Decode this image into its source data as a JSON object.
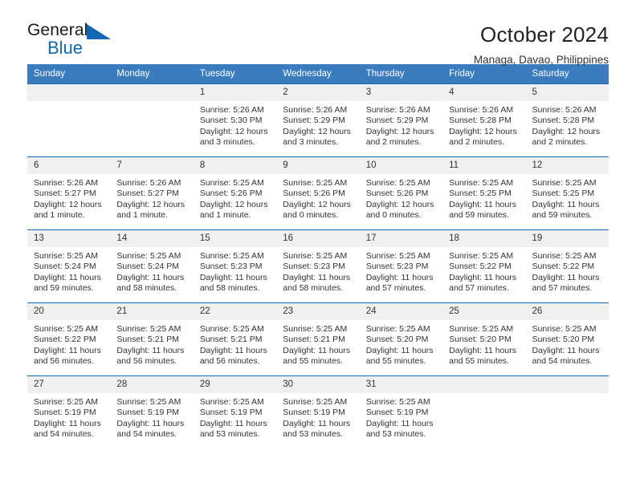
{
  "logo": {
    "word_top": "General",
    "word_bottom": "Blue",
    "accent_color": "#1268b3"
  },
  "header": {
    "title": "October 2024",
    "subtitle": "Managa, Davao, Philippines"
  },
  "calendar": {
    "header_bg": "#3a7cbe",
    "weekday_headers": [
      "Sunday",
      "Monday",
      "Tuesday",
      "Wednesday",
      "Thursday",
      "Friday",
      "Saturday"
    ],
    "weeks": [
      [
        {
          "day": "",
          "lines": []
        },
        {
          "day": "",
          "lines": []
        },
        {
          "day": "1",
          "lines": [
            "Sunrise: 5:26 AM",
            "Sunset: 5:30 PM",
            "Daylight: 12 hours",
            "and 3 minutes."
          ]
        },
        {
          "day": "2",
          "lines": [
            "Sunrise: 5:26 AM",
            "Sunset: 5:29 PM",
            "Daylight: 12 hours",
            "and 3 minutes."
          ]
        },
        {
          "day": "3",
          "lines": [
            "Sunrise: 5:26 AM",
            "Sunset: 5:29 PM",
            "Daylight: 12 hours",
            "and 2 minutes."
          ]
        },
        {
          "day": "4",
          "lines": [
            "Sunrise: 5:26 AM",
            "Sunset: 5:28 PM",
            "Daylight: 12 hours",
            "and 2 minutes."
          ]
        },
        {
          "day": "5",
          "lines": [
            "Sunrise: 5:26 AM",
            "Sunset: 5:28 PM",
            "Daylight: 12 hours",
            "and 2 minutes."
          ]
        }
      ],
      [
        {
          "day": "6",
          "lines": [
            "Sunrise: 5:26 AM",
            "Sunset: 5:27 PM",
            "Daylight: 12 hours",
            "and 1 minute."
          ]
        },
        {
          "day": "7",
          "lines": [
            "Sunrise: 5:26 AM",
            "Sunset: 5:27 PM",
            "Daylight: 12 hours",
            "and 1 minute."
          ]
        },
        {
          "day": "8",
          "lines": [
            "Sunrise: 5:25 AM",
            "Sunset: 5:26 PM",
            "Daylight: 12 hours",
            "and 1 minute."
          ]
        },
        {
          "day": "9",
          "lines": [
            "Sunrise: 5:25 AM",
            "Sunset: 5:26 PM",
            "Daylight: 12 hours",
            "and 0 minutes."
          ]
        },
        {
          "day": "10",
          "lines": [
            "Sunrise: 5:25 AM",
            "Sunset: 5:26 PM",
            "Daylight: 12 hours",
            "and 0 minutes."
          ]
        },
        {
          "day": "11",
          "lines": [
            "Sunrise: 5:25 AM",
            "Sunset: 5:25 PM",
            "Daylight: 11 hours",
            "and 59 minutes."
          ]
        },
        {
          "day": "12",
          "lines": [
            "Sunrise: 5:25 AM",
            "Sunset: 5:25 PM",
            "Daylight: 11 hours",
            "and 59 minutes."
          ]
        }
      ],
      [
        {
          "day": "13",
          "lines": [
            "Sunrise: 5:25 AM",
            "Sunset: 5:24 PM",
            "Daylight: 11 hours",
            "and 59 minutes."
          ]
        },
        {
          "day": "14",
          "lines": [
            "Sunrise: 5:25 AM",
            "Sunset: 5:24 PM",
            "Daylight: 11 hours",
            "and 58 minutes."
          ]
        },
        {
          "day": "15",
          "lines": [
            "Sunrise: 5:25 AM",
            "Sunset: 5:23 PM",
            "Daylight: 11 hours",
            "and 58 minutes."
          ]
        },
        {
          "day": "16",
          "lines": [
            "Sunrise: 5:25 AM",
            "Sunset: 5:23 PM",
            "Daylight: 11 hours",
            "and 58 minutes."
          ]
        },
        {
          "day": "17",
          "lines": [
            "Sunrise: 5:25 AM",
            "Sunset: 5:23 PM",
            "Daylight: 11 hours",
            "and 57 minutes."
          ]
        },
        {
          "day": "18",
          "lines": [
            "Sunrise: 5:25 AM",
            "Sunset: 5:22 PM",
            "Daylight: 11 hours",
            "and 57 minutes."
          ]
        },
        {
          "day": "19",
          "lines": [
            "Sunrise: 5:25 AM",
            "Sunset: 5:22 PM",
            "Daylight: 11 hours",
            "and 57 minutes."
          ]
        }
      ],
      [
        {
          "day": "20",
          "lines": [
            "Sunrise: 5:25 AM",
            "Sunset: 5:22 PM",
            "Daylight: 11 hours",
            "and 56 minutes."
          ]
        },
        {
          "day": "21",
          "lines": [
            "Sunrise: 5:25 AM",
            "Sunset: 5:21 PM",
            "Daylight: 11 hours",
            "and 56 minutes."
          ]
        },
        {
          "day": "22",
          "lines": [
            "Sunrise: 5:25 AM",
            "Sunset: 5:21 PM",
            "Daylight: 11 hours",
            "and 56 minutes."
          ]
        },
        {
          "day": "23",
          "lines": [
            "Sunrise: 5:25 AM",
            "Sunset: 5:21 PM",
            "Daylight: 11 hours",
            "and 55 minutes."
          ]
        },
        {
          "day": "24",
          "lines": [
            "Sunrise: 5:25 AM",
            "Sunset: 5:20 PM",
            "Daylight: 11 hours",
            "and 55 minutes."
          ]
        },
        {
          "day": "25",
          "lines": [
            "Sunrise: 5:25 AM",
            "Sunset: 5:20 PM",
            "Daylight: 11 hours",
            "and 55 minutes."
          ]
        },
        {
          "day": "26",
          "lines": [
            "Sunrise: 5:25 AM",
            "Sunset: 5:20 PM",
            "Daylight: 11 hours",
            "and 54 minutes."
          ]
        }
      ],
      [
        {
          "day": "27",
          "lines": [
            "Sunrise: 5:25 AM",
            "Sunset: 5:19 PM",
            "Daylight: 11 hours",
            "and 54 minutes."
          ]
        },
        {
          "day": "28",
          "lines": [
            "Sunrise: 5:25 AM",
            "Sunset: 5:19 PM",
            "Daylight: 11 hours",
            "and 54 minutes."
          ]
        },
        {
          "day": "29",
          "lines": [
            "Sunrise: 5:25 AM",
            "Sunset: 5:19 PM",
            "Daylight: 11 hours",
            "and 53 minutes."
          ]
        },
        {
          "day": "30",
          "lines": [
            "Sunrise: 5:25 AM",
            "Sunset: 5:19 PM",
            "Daylight: 11 hours",
            "and 53 minutes."
          ]
        },
        {
          "day": "31",
          "lines": [
            "Sunrise: 5:25 AM",
            "Sunset: 5:19 PM",
            "Daylight: 11 hours",
            "and 53 minutes."
          ]
        },
        {
          "day": "",
          "lines": []
        },
        {
          "day": "",
          "lines": []
        }
      ]
    ]
  }
}
